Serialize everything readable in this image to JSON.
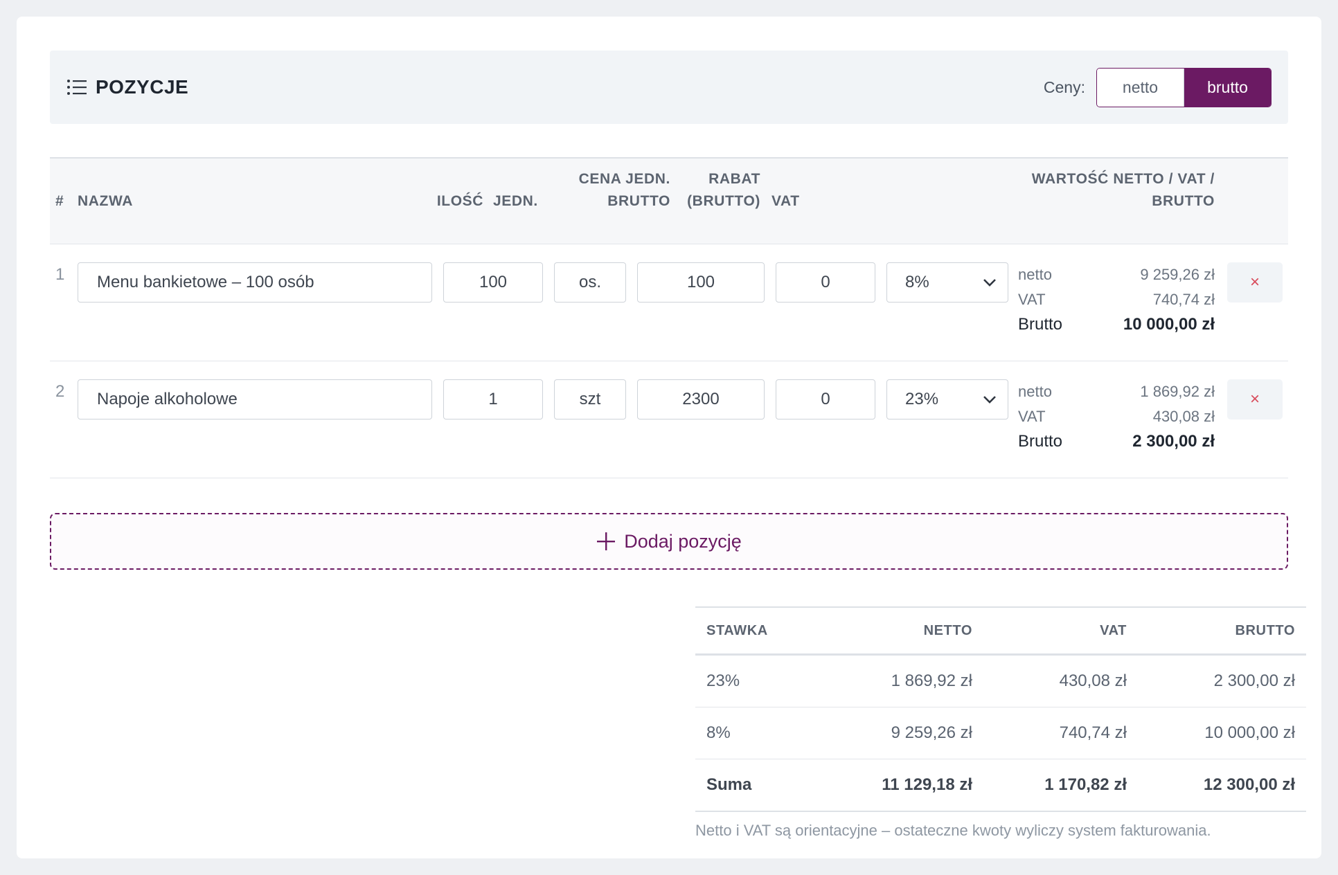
{
  "header": {
    "title": "POZYCJE",
    "prices_label": "Ceny:",
    "toggle": {
      "netto": "netto",
      "brutto": "brutto",
      "active": "brutto"
    }
  },
  "columns": {
    "hash": "#",
    "name": "NAZWA",
    "qty": "ILOŚĆ",
    "unit": "JEDN.",
    "price_l1": "CENA JEDN.",
    "price_l2": "BRUTTO",
    "discount_l1": "RABAT",
    "discount_l2": "(BRUTTO)",
    "vat": "VAT",
    "value_l1": "WARTOŚĆ NETTO / VAT /",
    "value_l2": "BRUTTO"
  },
  "items": [
    {
      "num": "1",
      "name": "Menu bankietowe – 100 osób",
      "qty": "100",
      "unit": "os.",
      "price": "100",
      "discount": "0",
      "vat_rate": "8%",
      "netto_label": "netto",
      "netto": "9 259,26 zł",
      "vat_label": "VAT",
      "vat": "740,74 zł",
      "brutto_label": "Brutto",
      "brutto": "10 000,00 zł",
      "delete": "×"
    },
    {
      "num": "2",
      "name": "Napoje alkoholowe",
      "qty": "1",
      "unit": "szt",
      "price": "2300",
      "discount": "0",
      "vat_rate": "23%",
      "netto_label": "netto",
      "netto": "1 869,92 zł",
      "vat_label": "VAT",
      "vat": "430,08 zł",
      "brutto_label": "Brutto",
      "brutto": "2 300,00 zł",
      "delete": "×"
    }
  ],
  "add_button": "Dodaj pozycję",
  "summary": {
    "headers": {
      "rate": "STAWKA",
      "netto": "NETTO",
      "vat": "VAT",
      "brutto": "BRUTTO"
    },
    "rows": [
      {
        "rate": "23%",
        "netto": "1 869,92 zł",
        "vat": "430,08 zł",
        "brutto": "2 300,00 zł"
      },
      {
        "rate": "8%",
        "netto": "9 259,26 zł",
        "vat": "740,74 zł",
        "brutto": "10 000,00 zł"
      }
    ],
    "total": {
      "label": "Suma",
      "netto": "11 129,18 zł",
      "vat": "1 170,82 zł",
      "brutto": "12 300,00 zł"
    },
    "note": "Netto i VAT są orientacyjne – ostateczne kwoty wyliczy system fakturowania."
  },
  "colors": {
    "accent": "#6b1a63",
    "danger": "#d84a5a"
  },
  "icons": {
    "section": "list-icon",
    "select": "chevron-down-icon",
    "delete": "close-icon",
    "add": "plus-icon"
  }
}
